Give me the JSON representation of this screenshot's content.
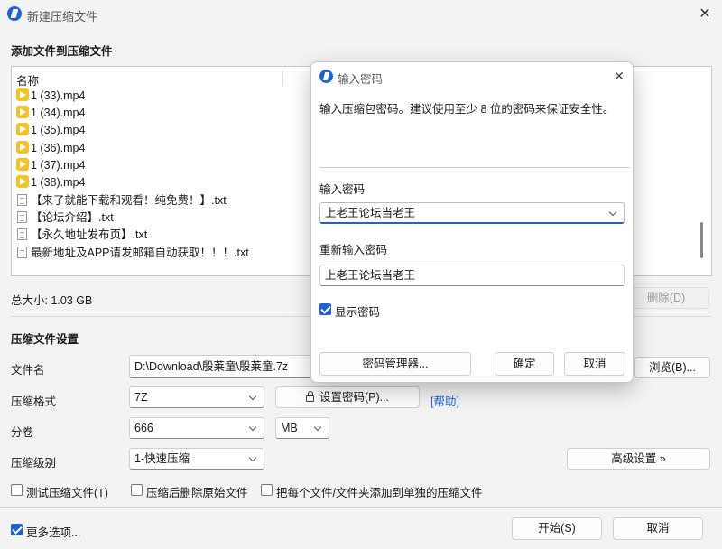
{
  "window": {
    "title": "新建压缩文件",
    "close_glyph": "✕"
  },
  "add_files": {
    "heading": "添加文件到压缩文件",
    "column_name": "名称",
    "files": [
      {
        "name": "1 (33).mp4",
        "icon": "video-file-icon"
      },
      {
        "name": "1 (34).mp4",
        "icon": "video-file-icon"
      },
      {
        "name": "1 (35).mp4",
        "icon": "video-file-icon"
      },
      {
        "name": "1 (36).mp4",
        "icon": "video-file-icon"
      },
      {
        "name": "1 (37).mp4",
        "icon": "video-file-icon"
      },
      {
        "name": "1 (38).mp4",
        "icon": "video-file-icon"
      },
      {
        "name": "【来了就能下载和观看！纯免费！】.txt",
        "icon": "text-file-icon"
      },
      {
        "name": "【论坛介绍】.txt",
        "icon": "text-file-icon"
      },
      {
        "name": "【永久地址发布页】.txt",
        "icon": "text-file-icon"
      },
      {
        "name": "最新地址及APP请发邮箱自动获取！！！.txt",
        "icon": "text-file-icon"
      }
    ],
    "total_size": "总大小: 1.03 GB",
    "delete_label": "删除(D)"
  },
  "settings": {
    "heading": "压缩文件设置",
    "filename_label": "文件名",
    "filename_value": "D:\\Download\\殷莱童\\殷莱童.7z",
    "browse_label": "浏览(B)...",
    "format_label": "压缩格式",
    "format_value": "7Z",
    "set_password_label": "设置密码(P)...",
    "help_label": "[帮助]",
    "split_label": "分卷",
    "split_value": "666",
    "split_unit": "MB",
    "level_label": "压缩级别",
    "level_value": "1-快速压缩",
    "advanced_label": "高级设置 »",
    "test_label": "测试压缩文件(T)",
    "delete_after_label": "压缩后删除原始文件",
    "each_separate_label": "把每个文件/文件夹添加到单独的压缩文件",
    "more_options_label": "更多选项..."
  },
  "footer": {
    "start_label": "开始(S)",
    "cancel_label": "取消"
  },
  "password_dialog": {
    "title": "输入密码",
    "close_glyph": "✕",
    "description": "输入压缩包密码。建议使用至少 8 位的密码来保证安全性。",
    "enter_label": "输入密码",
    "enter_value": "上老王论坛当老王",
    "reenter_label": "重新输入密码",
    "reenter_value": "上老王论坛当老王",
    "show_password_label": "显示密码",
    "manager_label": "密码管理器...",
    "ok_label": "确定",
    "cancel_label": "取消"
  },
  "colors": {
    "accent": "#1e63d6",
    "video_icon": "#f4c127"
  }
}
